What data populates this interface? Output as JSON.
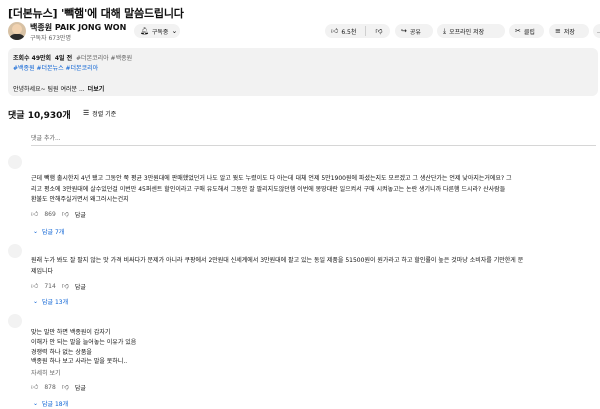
{
  "video": {
    "title": "[더본뉴스] '빽햄'에 대해 말씀드립니다"
  },
  "channel": {
    "name": "백종원 PAIK JONG WON",
    "subscribers": "구독자 673만명",
    "subscribe_label": "구독중",
    "subscribe_icon": "bell-icon"
  },
  "actions": {
    "like_count": "6.5천",
    "share_label": "공유",
    "offline_label": "오프라인 저장",
    "clip_label": "클립",
    "save_label": "저장",
    "more_label": "…"
  },
  "description": {
    "views": "조회수 49만회",
    "age": "4일 전",
    "inline_tags": "#더본코리아 #백종원",
    "hashtags": "#백종원 #더본뉴스 #더본코리아",
    "text": "안녕하세요~ 팀원 여러분  ...",
    "more_label": "더보기"
  },
  "comments_header": {
    "count": "댓글 10,930개",
    "sort_label": "정렬 기준",
    "add_placeholder": "댓글 추가..."
  },
  "comments": [
    {
      "lines": [
        "근데 빽햄 출시한지 4년 됐고 그동안 쭉 평균 3만원대에 판매했었던거 나도 알고 뭣도 누렸이도 다 아는데 대체 언제 5만1900원에 파셨는지도 모르겠고 그 생산단가는 언제 낮아지는거에요? 그",
        "리고 평소에 3만원대에 살수있던걸 이번만 45퍼센트 할인이라고 구매 유도해서 그동안 잘 팔리지도않던햄 이번에 몽땅대란 일으켜서 구매 시켜놓고는 논란 생기니까 다른햄 드시라? 산사람들",
        "환불도 안해주실거면서 왜그러시는건지"
      ],
      "likes": "869",
      "reply_label": "답글",
      "replies": "답글 7개"
    },
    {
      "lines": [
        "원래 누가 봐도 잘 팔지 않는 맛 가격 비싸다가 문제가 아니라 쿠팡에서 2만원대 신세계에서 3만원대에 팔고 있는 동일 제품을 51500원이 원가라고 하고 할인률이 높은 것마냥 소비자를 기만한게 문",
        "제입니다"
      ],
      "likes": "714",
      "reply_label": "답글",
      "replies": "답글 13개"
    },
    {
      "lines": [
        "맞는 말만 하면 백종원이 갑자기",
        "이해가 안 되는 말을 늘어놓는 이유가 있음",
        "경쟁력 하나 없는 상품을",
        "백종원 하나 보고 사라는 말을 못하니.."
      ],
      "see_more": "자세히 보기",
      "likes": "878",
      "reply_label": "답글",
      "replies": "답글 18개"
    }
  ]
}
